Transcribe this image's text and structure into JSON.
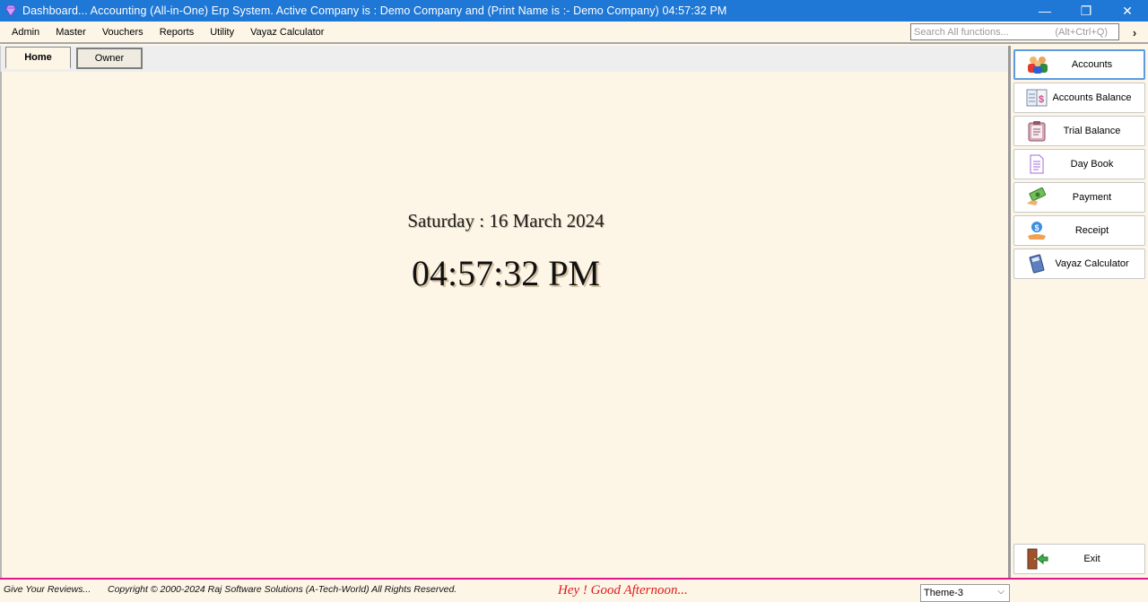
{
  "window": {
    "title": "Dashboard... Accounting (All-in-One) Erp System. Active Company is :  Demo Company and (Print Name is :- Demo Company)   04:57:32 PM",
    "minimize": "—",
    "restore": "❐",
    "close": "✕"
  },
  "menu": {
    "items": [
      {
        "label": "Admin"
      },
      {
        "label": "Master"
      },
      {
        "label": "Vouchers"
      },
      {
        "label": "Reports"
      },
      {
        "label": "Utility"
      },
      {
        "label": "Vayaz Calculator"
      }
    ],
    "search_placeholder": "Search All functions...",
    "search_shortcut": "(Alt+Ctrl+Q)",
    "more_arrow": "›"
  },
  "tabs": [
    {
      "label": "Home"
    },
    {
      "label": "Owner"
    }
  ],
  "main": {
    "date": "Saturday : 16 March 2024",
    "time": "04:57:32 PM"
  },
  "sidebar": {
    "buttons": [
      {
        "label": "Accounts",
        "icon": "users-icon"
      },
      {
        "label": "Accounts Balance",
        "icon": "ledger-icon"
      },
      {
        "label": "Trial Balance",
        "icon": "clipboard-icon"
      },
      {
        "label": "Day Book",
        "icon": "document-icon"
      },
      {
        "label": "Payment",
        "icon": "money-icon"
      },
      {
        "label": "Receipt",
        "icon": "receipt-icon"
      },
      {
        "label": "Vayaz Calculator",
        "icon": "calculator-icon"
      }
    ],
    "exit": {
      "label": "Exit",
      "icon": "exit-door-icon"
    }
  },
  "status": {
    "reviews": "Give Your Reviews...",
    "copyright": "Copyright © 2000-2024 Raj Software Solutions (A-Tech-World) All Rights Reserved.",
    "greeting": "Hey !   Good Afternoon...",
    "theme": "Theme-3"
  },
  "colors": {
    "titlebar": "#1f78d6",
    "background": "#fdf5e6",
    "statusbar_border": "#e0188c",
    "greeting": "#e01a1a"
  }
}
